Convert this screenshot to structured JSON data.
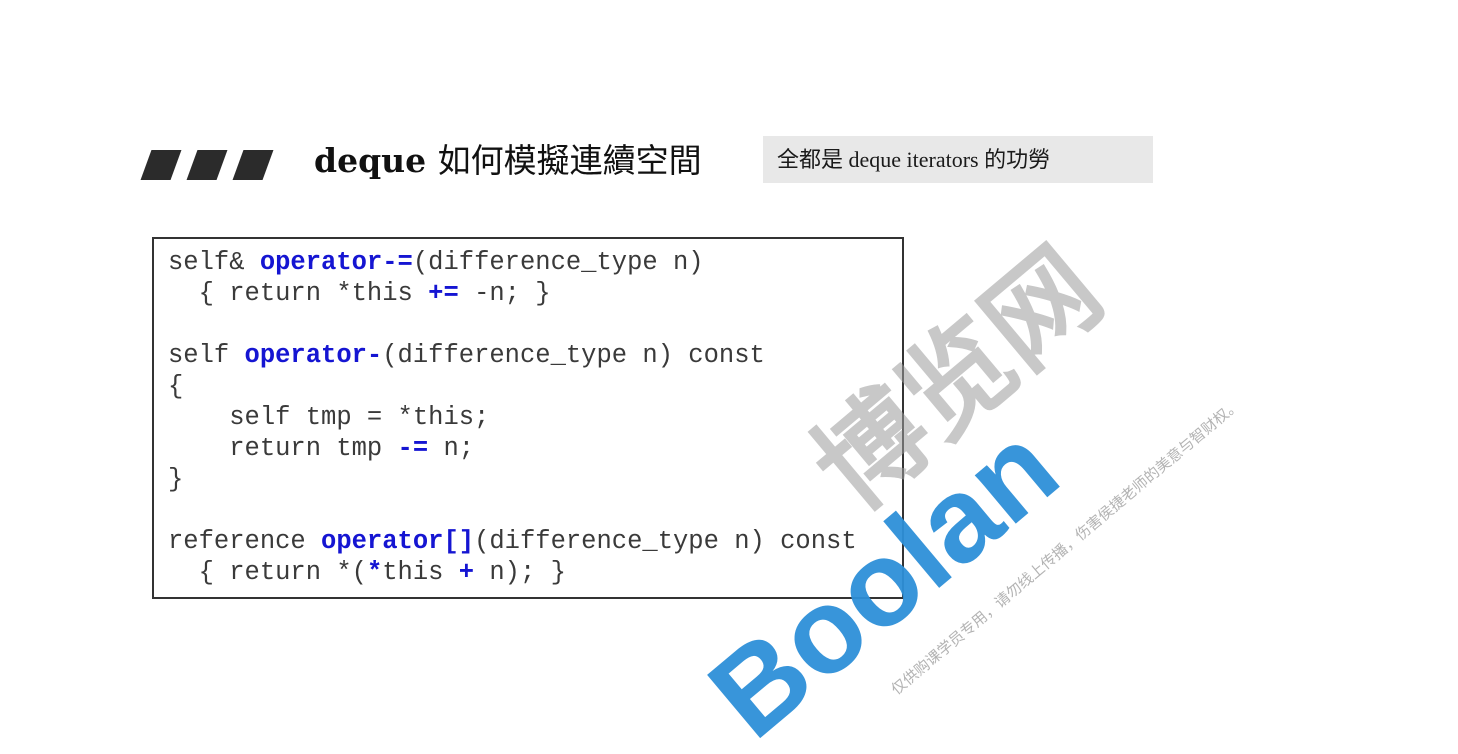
{
  "slide": {
    "title_en": "deque",
    "title_cn": "如何模擬連續空間",
    "subtitle": "全都是 deque iterators 的功勞"
  },
  "code": {
    "lines": [
      [
        {
          "t": "self& "
        },
        {
          "t": "operator-=",
          "kw": true
        },
        {
          "t": "(difference_type n)"
        }
      ],
      [
        {
          "t": "  { return *this "
        },
        {
          "t": "+=",
          "kw": true
        },
        {
          "t": " -n; }"
        }
      ],
      [],
      [
        {
          "t": "self "
        },
        {
          "t": "operator-",
          "kw": true
        },
        {
          "t": "(difference_type n) const"
        }
      ],
      [
        {
          "t": "{"
        }
      ],
      [
        {
          "t": "    self tmp = *this;"
        }
      ],
      [
        {
          "t": "    return tmp "
        },
        {
          "t": "-=",
          "kw": true
        },
        {
          "t": " n;"
        }
      ],
      [
        {
          "t": "}"
        }
      ],
      [],
      [
        {
          "t": "reference "
        },
        {
          "t": "operator[]",
          "kw": true
        },
        {
          "t": "(difference_type n) const"
        }
      ],
      [
        {
          "t": "  { return *("
        },
        {
          "t": "*",
          "kw": true
        },
        {
          "t": "this "
        },
        {
          "t": "+",
          "kw": true
        },
        {
          "t": " n); }"
        }
      ]
    ]
  },
  "watermark": {
    "brand": "Boolan",
    "cn": "博览网",
    "notice": "仅供购课学员专用，请勿线上传播，伤害侯捷老师的美意与智财权。",
    "color": "#2d8fd8"
  }
}
